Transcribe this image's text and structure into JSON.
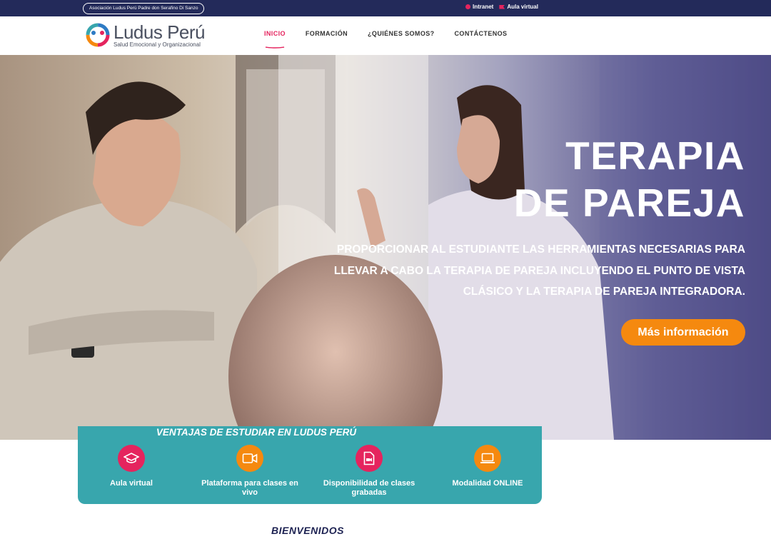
{
  "topbar": {
    "association": "Asociación Ludus Perú Padre don Serafino Di Sanzo",
    "links": [
      {
        "label": "Intranet",
        "icon": "map-pin-icon"
      },
      {
        "label": "Aula virtual",
        "icon": "flag-icon"
      }
    ]
  },
  "brand": {
    "name": "Ludus Perú",
    "tagline": "Salud Emocional y Organizacional"
  },
  "nav": {
    "items": [
      {
        "label": "INICIO",
        "active": true
      },
      {
        "label": "FORMACIÓN",
        "active": false
      },
      {
        "label": "¿QUIÉNES SOMOS?",
        "active": false
      },
      {
        "label": "CONTÁCTENOS",
        "active": false
      }
    ]
  },
  "hero": {
    "title_line1": "TERAPIA",
    "title_line2": "DE PAREJA",
    "description": "Proporcionar al estudiante las herramientas necesarias para llevar a cabo la terapia de pareja incluyendo el punto de vista clásico y la terapia de pareja integradora.",
    "button": "Más información"
  },
  "benefits": {
    "title": "VENTAJAS DE ESTUDIAR EN LUDUS PERÚ",
    "items": [
      {
        "label": "Aula virtual",
        "icon": "graduation-cap-icon"
      },
      {
        "label": "Plataforma para clases en vivo",
        "icon": "video-camera-icon"
      },
      {
        "label": "Disponibilidad de clases grabadas",
        "icon": "video-file-icon"
      },
      {
        "label": "Modalidad ONLINE",
        "icon": "laptop-icon"
      }
    ]
  },
  "welcome": "BIENVENIDOS",
  "colors": {
    "topbar": "#232a5a",
    "accent_pink": "#e5245e",
    "accent_orange": "#f5890f",
    "benefits_teal": "#38a6ad",
    "welcome_navy": "#1d2252"
  }
}
